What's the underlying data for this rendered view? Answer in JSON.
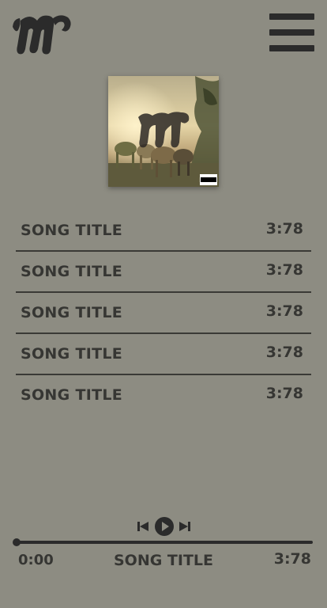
{
  "app": {
    "logo_text": "M",
    "menu_icon": "hamburger-menu-icon"
  },
  "album": {
    "art_icon": "album-cover-image",
    "advisory_label": "PARENTAL ADVISORY EXPLICIT CONTENT"
  },
  "tracks": [
    {
      "title": "SONG TITLE",
      "duration": "3:78"
    },
    {
      "title": "SONG TITLE",
      "duration": "3:78"
    },
    {
      "title": "SONG TITLE",
      "duration": "3:78"
    },
    {
      "title": "SONG TITLE",
      "duration": "3:78"
    },
    {
      "title": "SONG TITLE",
      "duration": "3:78"
    }
  ],
  "player": {
    "prev_icon": "skip-previous-icon",
    "play_icon": "play-icon",
    "next_icon": "skip-next-icon",
    "elapsed": "0:00",
    "now_playing_title": "SONG TITLE",
    "total": "3:78",
    "progress": 0
  },
  "colors": {
    "background": "#8d8c82",
    "foreground": "#2b2b2b"
  }
}
